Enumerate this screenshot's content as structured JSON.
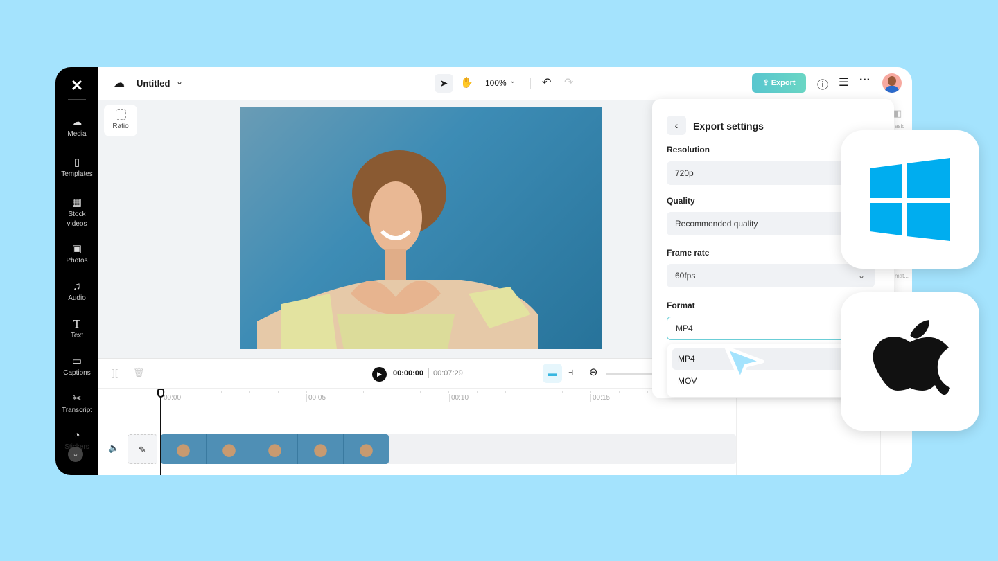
{
  "app": {
    "title": "Untitled",
    "zoom": "100%"
  },
  "sidebar": {
    "items": [
      {
        "label": "Media",
        "icon": "☁"
      },
      {
        "label": "Templates",
        "icon": "▯"
      },
      {
        "label": "Stock videos",
        "icon": "▦"
      },
      {
        "label": "Photos",
        "icon": "▣"
      },
      {
        "label": "Audio",
        "icon": "♫"
      },
      {
        "label": "Text",
        "icon": "T"
      },
      {
        "label": "Captions",
        "icon": "▭"
      },
      {
        "label": "Transcript",
        "icon": "✂"
      },
      {
        "label": "Stickers",
        "icon": "◔"
      }
    ]
  },
  "toolbar": {
    "export_label": "Export",
    "ratio_label": "Ratio"
  },
  "player": {
    "current": "00:00:00",
    "total": "00:07:29"
  },
  "ruler": [
    "00:00",
    "00:05",
    "00:10",
    "00:15"
  ],
  "export_settings": {
    "title": "Export settings",
    "resolution_label": "Resolution",
    "resolution": "720p",
    "quality_label": "Quality",
    "quality": "Recommended quality",
    "framerate_label": "Frame rate",
    "framerate": "60fps",
    "format_label": "Format",
    "format": "MP4",
    "format_options": [
      "MP4",
      "MOV"
    ]
  },
  "right_panel": {
    "basic": "asic",
    "format": "mat..."
  },
  "colors": {
    "background": "#a4e3fd",
    "export_button": "#5fcfcb",
    "windows": "#00adef",
    "apple": "#111111",
    "cursor": "#a4e3fd"
  }
}
